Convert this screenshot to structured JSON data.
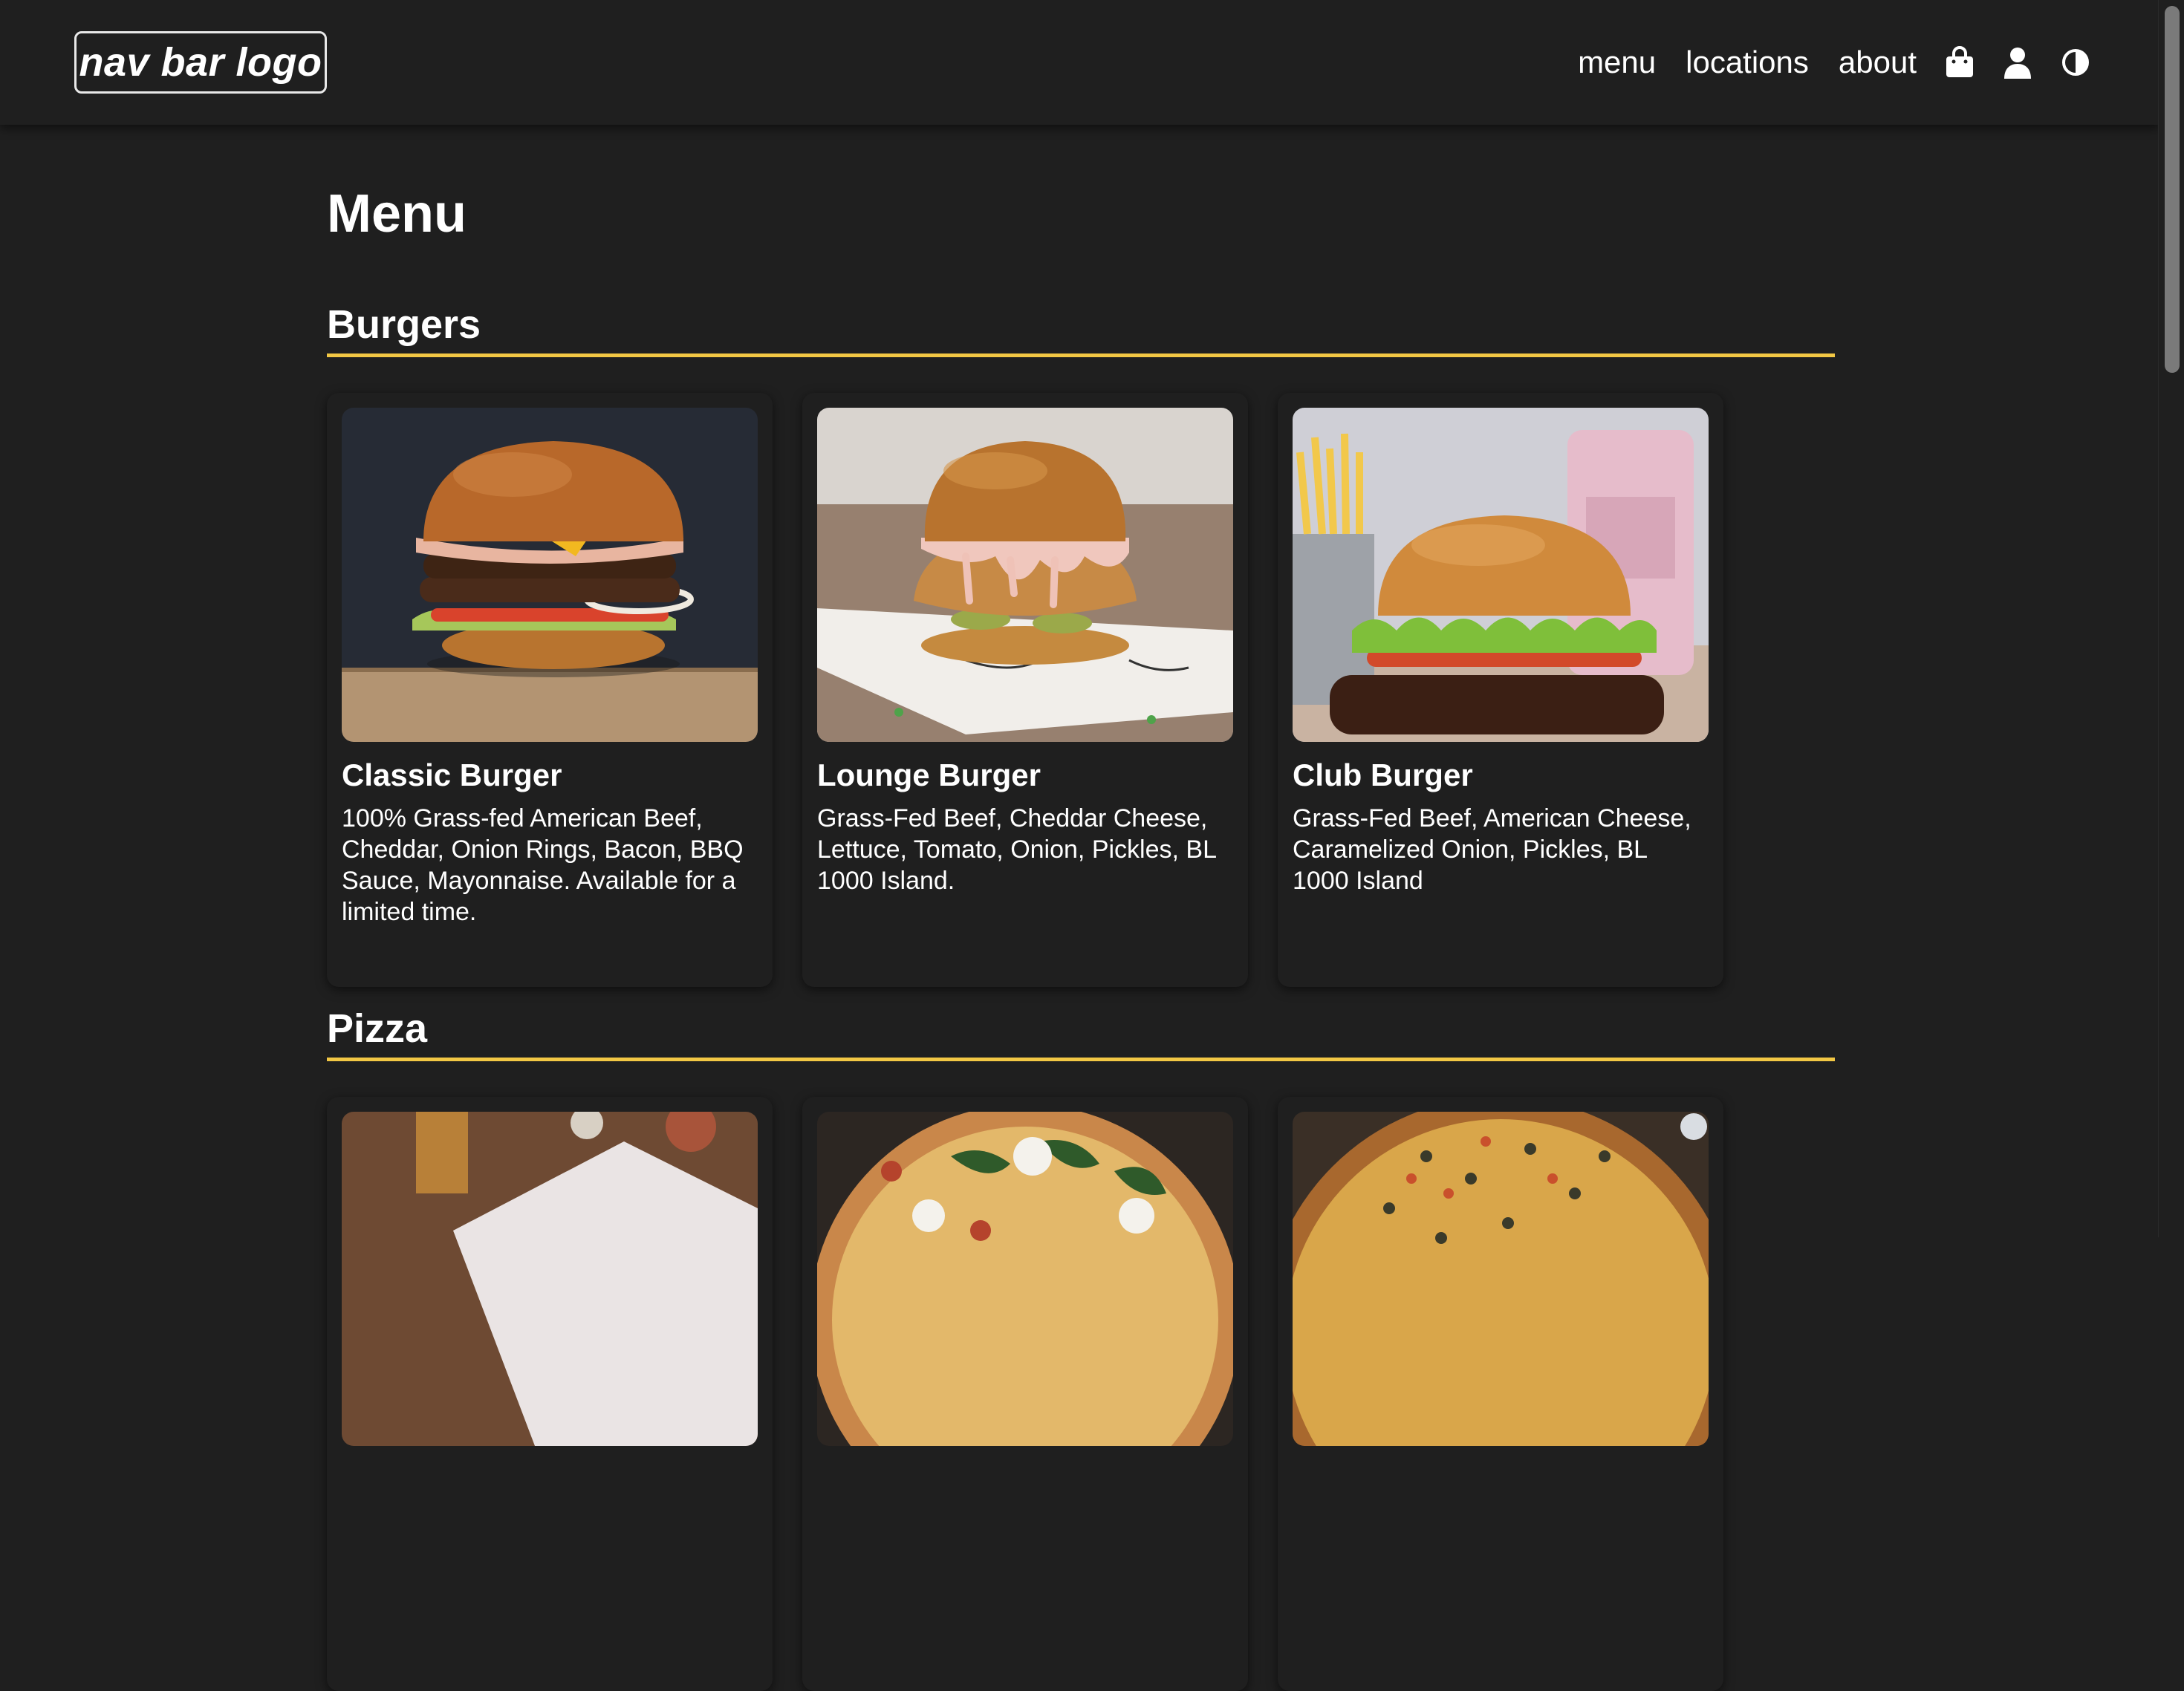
{
  "nav": {
    "logo": "nav bar logo",
    "links": [
      "menu",
      "locations",
      "about"
    ],
    "icons": [
      "shopping-bag-icon",
      "user-icon",
      "theme-toggle-icon"
    ]
  },
  "page": {
    "title": "Menu"
  },
  "sections": [
    {
      "title": "Burgers",
      "items": [
        {
          "name": "Classic Burger",
          "description": "100% Grass-fed American Beef, Cheddar, Onion Rings, Bacon, BBQ Sauce, Mayonnaise. Available for a limited time."
        },
        {
          "name": "Lounge Burger",
          "description": "Grass-Fed Beef, Cheddar Cheese, Lettuce, Tomato, Onion, Pickles, BL 1000 Island."
        },
        {
          "name": "Club Burger",
          "description": "Grass-Fed Beef, American Cheese, Caramelized Onion, Pickles, BL 1000 Island"
        }
      ]
    },
    {
      "title": "Pizza",
      "items": [
        {
          "name": "",
          "description": ""
        },
        {
          "name": "",
          "description": ""
        },
        {
          "name": "",
          "description": ""
        }
      ]
    }
  ],
  "colors": {
    "background": "#1f1f1f",
    "accent_underline": "#f2c744",
    "text": "#ffffff"
  }
}
